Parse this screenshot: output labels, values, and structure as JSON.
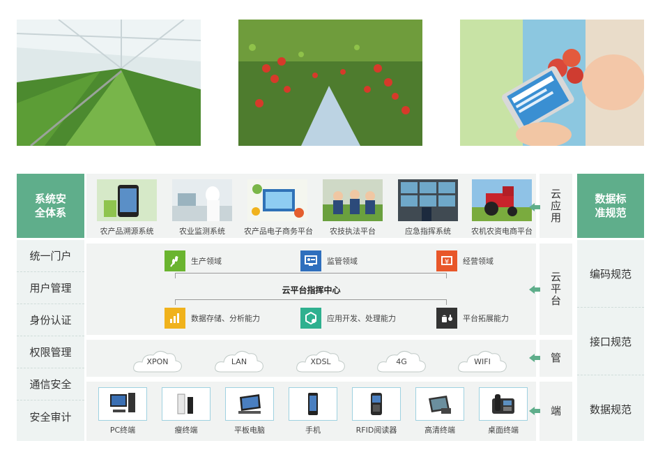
{
  "left": {
    "header": "系统安\n全体系",
    "items": [
      "统一门户",
      "用户管理",
      "身份认证",
      "权限管理",
      "通信安全",
      "安全审计"
    ]
  },
  "right": {
    "header": "数据标\n准规范",
    "items": [
      "编码规范",
      "接口规范",
      "数据规范"
    ]
  },
  "layers": {
    "cloud_app": "云应用",
    "cloud_platform": "云平台",
    "pipe": "管",
    "terminal": "端"
  },
  "cloud_apps": [
    "农产品溯源系统",
    "农业监测系统",
    "农产品电子商务平台",
    "农技执法平台",
    "应急指挥系统",
    "农机农资电商平台"
  ],
  "platform": {
    "domains": [
      "生产领域",
      "监管领域",
      "经营领域"
    ],
    "center": "云平台指挥中心",
    "capabilities": [
      "数据存储、分析能力",
      "应用开发、处理能力",
      "平台拓展能力"
    ]
  },
  "networks": [
    "XPON",
    "LAN",
    "XDSL",
    "4G",
    "WIFI"
  ],
  "terminals": [
    "PC终端",
    "瘦终端",
    "平板电脑",
    "手机",
    "RFID阅读器",
    "高清终端",
    "桌面终端"
  ],
  "colors": {
    "green": "#5fae8b",
    "panel": "#f1f3f2",
    "side": "#eef3f2",
    "orange": "#e8572a",
    "blue": "#2f6fbd",
    "lime": "#6ab42f",
    "yellow": "#f0b21c",
    "teal": "#2fb08f",
    "dark": "#333333"
  }
}
